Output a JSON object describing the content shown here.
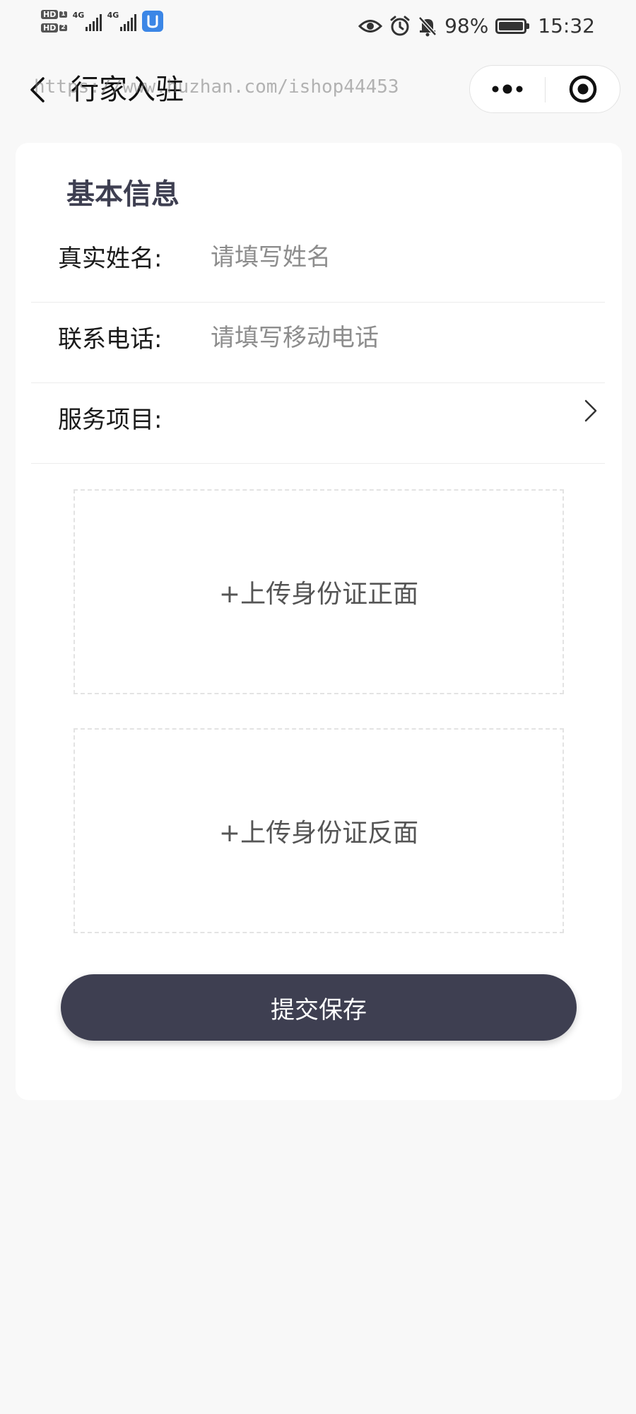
{
  "status_bar": {
    "sim1_tag": "HD",
    "sim1_num": "1",
    "sim2_tag": "HD",
    "sim2_num": "2",
    "network1": "4G",
    "network2": "4G",
    "battery_percent": "98%",
    "battery_level": 0.98,
    "time": "15:32",
    "icons": [
      "eye-icon",
      "alarm-icon",
      "mute-bell-icon",
      "battery-icon"
    ]
  },
  "nav": {
    "title": "行家入驻",
    "watermark": "https://www.huzhan.com/ishop44453"
  },
  "card": {
    "section_title": "基本信息",
    "name_row": {
      "label": "真实姓名:",
      "placeholder": "请填写姓名"
    },
    "phone_row": {
      "label": "联系电话:",
      "placeholder": "请填写移动电话"
    },
    "service_row": {
      "label": "服务项目:"
    },
    "upload_front": "+上传身份证正面",
    "upload_back": "+上传身份证反面",
    "submit_label": "提交保存"
  },
  "colors": {
    "primary": "#3e3f51",
    "background": "#f8f8f8",
    "card": "#ffffff",
    "placeholder": "#8d8d8d",
    "divider": "#ececec"
  }
}
